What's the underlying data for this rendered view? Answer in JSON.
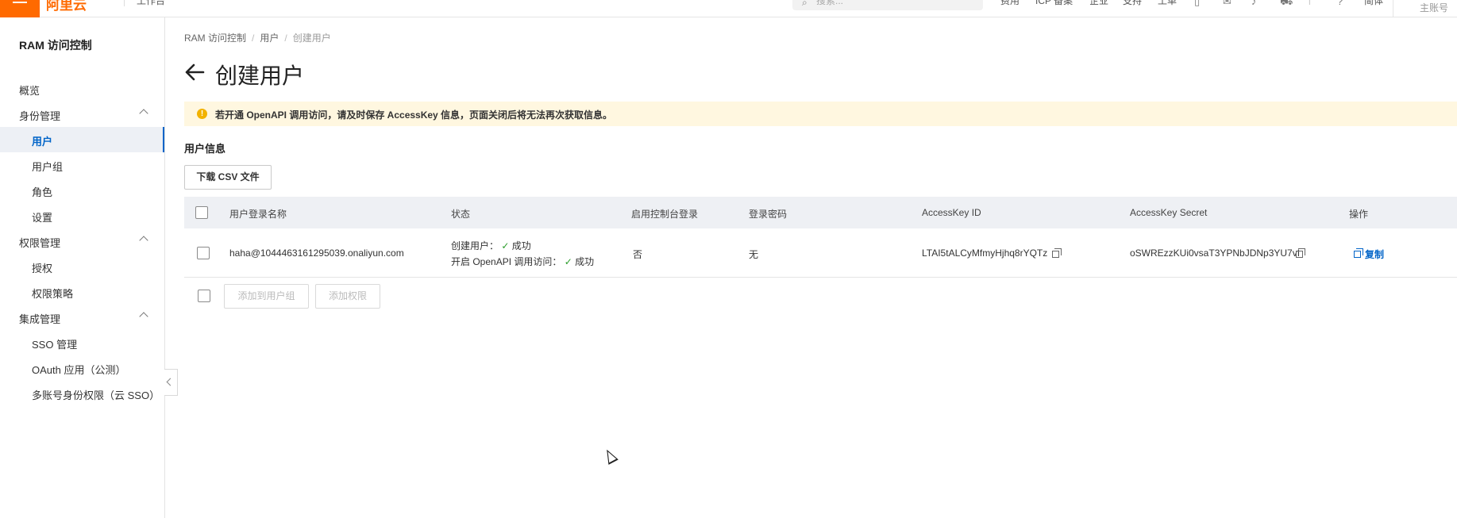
{
  "topbar": {
    "logo": "阿里云",
    "workbench": "工作台",
    "search_placeholder": "搜索...",
    "nav": [
      "费用",
      "ICP 备案",
      "企业",
      "支持",
      "工单"
    ],
    "help": "简体",
    "account": "主账号"
  },
  "sidebar": {
    "title": "RAM 访问控制",
    "items": [
      {
        "label": "概览"
      },
      {
        "label": "身份管理"
      },
      {
        "label": "用户"
      },
      {
        "label": "用户组"
      },
      {
        "label": "角色"
      },
      {
        "label": "设置"
      },
      {
        "label": "权限管理"
      },
      {
        "label": "授权"
      },
      {
        "label": "权限策略"
      },
      {
        "label": "集成管理"
      },
      {
        "label": "SSO 管理"
      },
      {
        "label": "OAuth 应用（公测）"
      },
      {
        "label": "多账号身份权限（云 SSO）"
      }
    ]
  },
  "breadcrumb": {
    "items": [
      "RAM 访问控制",
      "用户",
      "创建用户"
    ],
    "separator": "/"
  },
  "page": {
    "title": "创建用户"
  },
  "alert": {
    "text": "若开通 OpenAPI 调用访问，请及时保存 AccessKey 信息，页面关闭后将无法再次获取信息。",
    "icon": "!"
  },
  "section": {
    "title": "用户信息",
    "download_button": "下载 CSV 文件"
  },
  "table": {
    "headers": [
      "用户登录名称",
      "状态",
      "启用控制台登录",
      "登录密码",
      "AccessKey ID",
      "AccessKey Secret",
      "操作"
    ],
    "rows": [
      {
        "login_name": "haha@1044463161295039.onaliyun.com",
        "status_create_label": "创建用户：",
        "status_create_value": "成功",
        "status_api_label": "开启 OpenAPI 调用访问：",
        "status_api_value": "成功",
        "console_login": "否",
        "password": "无",
        "access_key_id": "LTAI5tALCyMfmyHjhq8rYQTz",
        "access_key_secret": "oSWREzzKUi0vsaT3YPNbJDNp3YU7vI",
        "action": "复制"
      }
    ]
  },
  "footer": {
    "add_to_group": "添加到用户组",
    "add_permission": "添加权限"
  },
  "colors": {
    "brand": "#ff6a00",
    "link": "#0064c8",
    "alert_bg": "#fff7e0",
    "success": "#2a9c2a"
  }
}
